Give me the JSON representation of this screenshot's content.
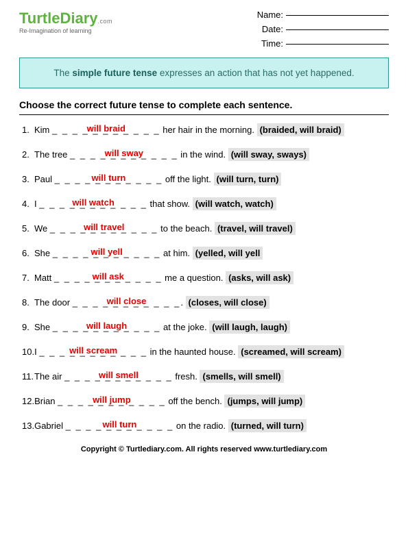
{
  "logo": {
    "main": "TurtleDiary",
    "ext": ".com",
    "tagline": "Re-Imagination of learning"
  },
  "meta": {
    "name_label": "Name:",
    "date_label": "Date:",
    "time_label": "Time:"
  },
  "info": {
    "pre": "The ",
    "bold": "simple future tense",
    "post": " expresses an action that has not yet happened."
  },
  "instruction": "Choose the correct future tense to complete each sentence.",
  "questions": [
    {
      "num": "1.",
      "pre": "Kim ",
      "ans": "will braid",
      "post": " her hair in the morning.  ",
      "choices": "(braided, will braid)"
    },
    {
      "num": "2.",
      "pre": "The tree ",
      "ans": "will sway",
      "post": " in the wind.  ",
      "choices": "(will sway, sways)"
    },
    {
      "num": "3.",
      "pre": "Paul ",
      "ans": "will turn",
      "post": " off the light.  ",
      "choices": "(will turn, turn)"
    },
    {
      "num": "4.",
      "pre": "I ",
      "ans": "will watch",
      "post": " that show.  ",
      "choices": "(will watch, watch)"
    },
    {
      "num": "5.",
      "pre": "We ",
      "ans": "will travel",
      "post": " to the beach.  ",
      "choices": "(travel, will travel)"
    },
    {
      "num": "6.",
      "pre": "She ",
      "ans": "will yell",
      "post": " at him.  ",
      "choices": "(yelled, will yell"
    },
    {
      "num": "7.",
      "pre": "Matt ",
      "ans": "will ask",
      "post": " me a question.  ",
      "choices": "(asks, will ask)"
    },
    {
      "num": "8.",
      "pre": "The door ",
      "ans": "will close",
      "post": ".  ",
      "choices": "(closes, will close)"
    },
    {
      "num": "9.",
      "pre": "She ",
      "ans": "will laugh",
      "post": " at the joke.  ",
      "choices": "(will laugh, laugh)"
    },
    {
      "num": "10.",
      "pre": "I ",
      "ans": "will scream",
      "post": " in the haunted house.  ",
      "choices": "(screamed, will scream)"
    },
    {
      "num": "11.",
      "pre": "The air ",
      "ans": "will smell",
      "post": " fresh.  ",
      "choices": "(smells, will smell)"
    },
    {
      "num": "12.",
      "pre": "Brian ",
      "ans": "will jump",
      "post": " off the bench.  ",
      "choices": "(jumps, will jump)"
    },
    {
      "num": "13.",
      "pre": "Gabriel ",
      "ans": "will turn",
      "post": " on the radio.  ",
      "choices": "(turned, will turn)"
    }
  ],
  "footer": "Copyright © Turtlediary.com. All rights reserved    www.turtlediary.com"
}
